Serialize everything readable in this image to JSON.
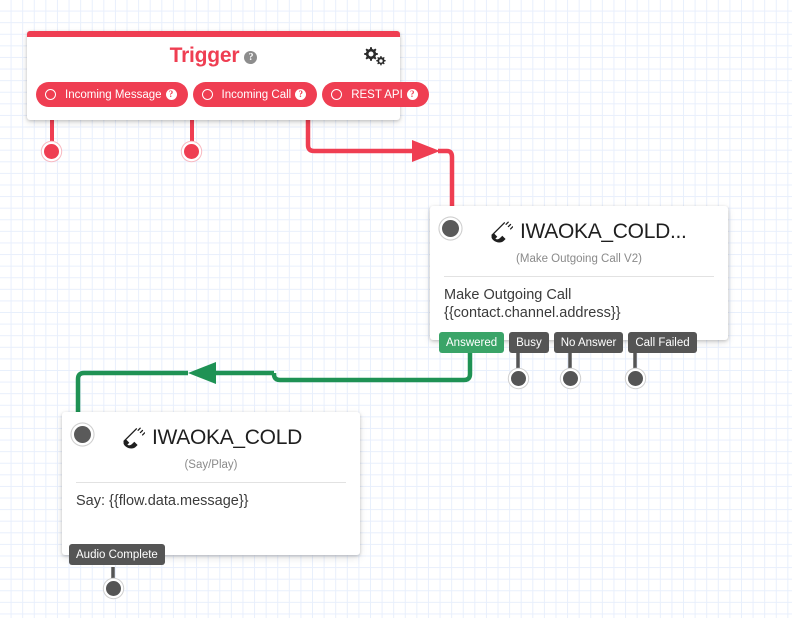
{
  "canvas": {
    "background_color": "#ffffff",
    "grid_color": "#e8effc"
  },
  "trigger": {
    "title": "Trigger",
    "help_glyph": "?",
    "accent_color": "#ef3e52",
    "gear_icon": "gear-icon",
    "pills": [
      {
        "label": "Incoming Message",
        "help_glyph": "?"
      },
      {
        "label": "Incoming Call",
        "help_glyph": "?"
      },
      {
        "label": "REST API",
        "help_glyph": "?"
      }
    ]
  },
  "call_widget": {
    "title": "IWAOKA_COLD...",
    "subtitle": "(Make Outgoing Call V2)",
    "body": "Make Outgoing Call\n{{contact.channel.address}}",
    "icon": "phone-icon",
    "outcomes": [
      {
        "label": "Answered",
        "color": "#3aa468"
      },
      {
        "label": "Busy",
        "color": "#555555"
      },
      {
        "label": "No Answer",
        "color": "#555555"
      },
      {
        "label": "Call Failed",
        "color": "#555555"
      }
    ]
  },
  "say_widget": {
    "title": "IWAOKA_COLD",
    "subtitle": "(Say/Play)",
    "body": "Say: {{flow.data.message}}",
    "icon": "phone-icon",
    "outcomes": [
      {
        "label": "Audio Complete",
        "color": "#555555"
      }
    ]
  },
  "connectors": {
    "trigger_color": "#ef3e52",
    "answered_color": "#1f9254"
  }
}
